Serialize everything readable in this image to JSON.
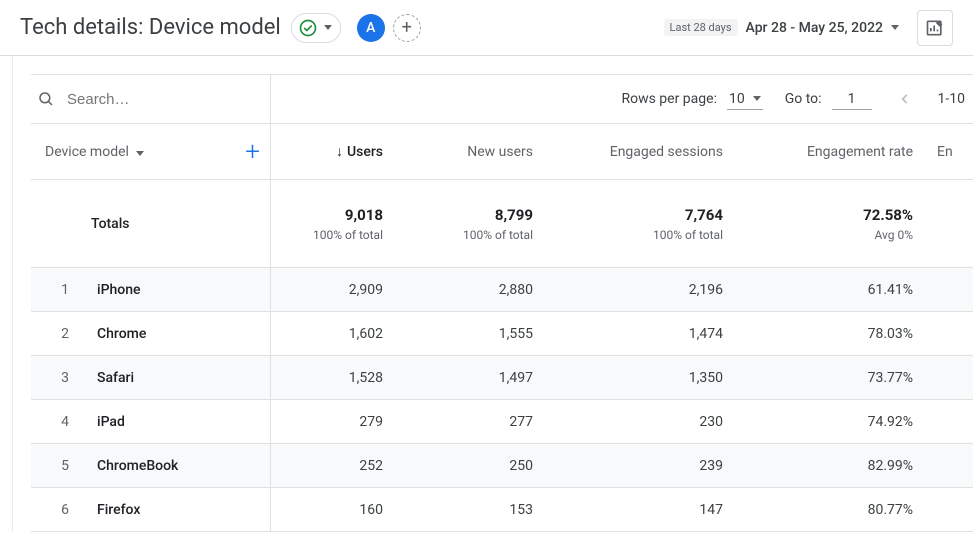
{
  "header": {
    "title": "Tech details: Device model",
    "avatar_letter": "A",
    "date_label": "Last 28 days",
    "date_range": "Apr 28 - May 25, 2022"
  },
  "search": {
    "placeholder": "Search…"
  },
  "paging": {
    "rows_per_page_label": "Rows per page:",
    "rows_per_page_value": "10",
    "goto_label": "Go to:",
    "goto_value": "1",
    "range_indicator": "1-10"
  },
  "columns": {
    "dimension_label": "Device model",
    "metrics": [
      "Users",
      "New users",
      "Engaged sessions",
      "Engagement rate"
    ],
    "trailing_metric_partial": "En",
    "sorted_index": 0
  },
  "totals": {
    "label": "Totals",
    "values": [
      "9,018",
      "8,799",
      "7,764",
      "72.58%"
    ],
    "subs": [
      "100% of total",
      "100% of total",
      "100% of total",
      "Avg 0%"
    ]
  },
  "rows": [
    {
      "idx": "1",
      "name": "iPhone",
      "values": [
        "2,909",
        "2,880",
        "2,196",
        "61.41%"
      ]
    },
    {
      "idx": "2",
      "name": "Chrome",
      "values": [
        "1,602",
        "1,555",
        "1,474",
        "78.03%"
      ]
    },
    {
      "idx": "3",
      "name": "Safari",
      "values": [
        "1,528",
        "1,497",
        "1,350",
        "73.77%"
      ]
    },
    {
      "idx": "4",
      "name": "iPad",
      "values": [
        "279",
        "277",
        "230",
        "74.92%"
      ]
    },
    {
      "idx": "5",
      "name": "ChromeBook",
      "values": [
        "252",
        "250",
        "239",
        "82.99%"
      ]
    },
    {
      "idx": "6",
      "name": "Firefox",
      "values": [
        "160",
        "153",
        "147",
        "80.77%"
      ]
    }
  ],
  "chart_data": {
    "type": "table",
    "dimension": "Device model",
    "metrics": [
      "Users",
      "New users",
      "Engaged sessions",
      "Engagement rate"
    ],
    "totals": {
      "Users": 9018,
      "New users": 8799,
      "Engaged sessions": 7764,
      "Engagement rate": 72.58
    },
    "rows": [
      {
        "Device model": "iPhone",
        "Users": 2909,
        "New users": 2880,
        "Engaged sessions": 2196,
        "Engagement rate": 61.41
      },
      {
        "Device model": "Chrome",
        "Users": 1602,
        "New users": 1555,
        "Engaged sessions": 1474,
        "Engagement rate": 78.03
      },
      {
        "Device model": "Safari",
        "Users": 1528,
        "New users": 1497,
        "Engaged sessions": 1350,
        "Engagement rate": 73.77
      },
      {
        "Device model": "iPad",
        "Users": 279,
        "New users": 277,
        "Engaged sessions": 230,
        "Engagement rate": 74.92
      },
      {
        "Device model": "ChromeBook",
        "Users": 252,
        "New users": 250,
        "Engaged sessions": 239,
        "Engagement rate": 82.99
      },
      {
        "Device model": "Firefox",
        "Users": 160,
        "New users": 153,
        "Engaged sessions": 147,
        "Engagement rate": 80.77
      }
    ]
  }
}
